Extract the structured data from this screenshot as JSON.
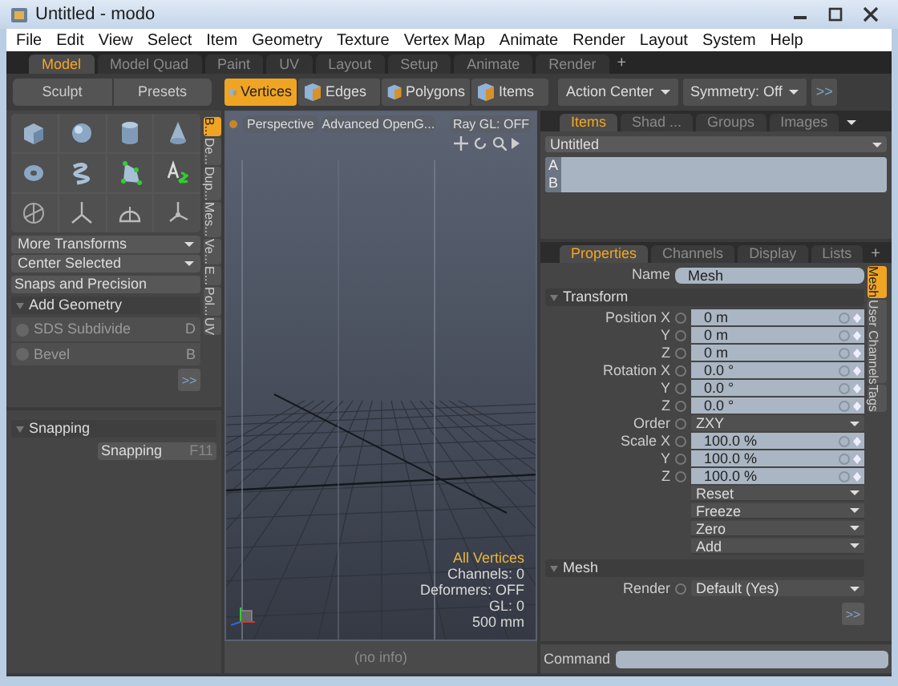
{
  "window": {
    "title": "Untitled - modo"
  },
  "menu": [
    "File",
    "Edit",
    "View",
    "Select",
    "Item",
    "Geometry",
    "Texture",
    "Vertex Map",
    "Animate",
    "Render",
    "Layout",
    "System",
    "Help"
  ],
  "layout_tabs": [
    {
      "label": "Model",
      "selected": true
    },
    {
      "label": "Model Quad",
      "selected": false
    },
    {
      "label": "Paint",
      "selected": false
    },
    {
      "label": "UV",
      "selected": false
    },
    {
      "label": "Layout",
      "selected": false
    },
    {
      "label": "Setup",
      "selected": false
    },
    {
      "label": "Animate",
      "selected": false
    },
    {
      "label": "Render",
      "selected": false
    }
  ],
  "add_tab": "+",
  "toolbar": {
    "left_buttons": [
      "Sculpt",
      "Presets"
    ],
    "modes": [
      {
        "label": "Vertices",
        "selected": true
      },
      {
        "label": "Edges",
        "selected": false
      },
      {
        "label": "Polygons",
        "selected": false
      },
      {
        "label": "Items",
        "selected": false
      }
    ],
    "action_center": "Action Center",
    "symmetry": "Symmetry: Off",
    "more": ">>"
  },
  "tool_panel": {
    "dropdowns": [
      "More Transforms",
      "Center Selected"
    ],
    "snaps": "Snaps and Precision",
    "add_geometry": {
      "title": "Add Geometry",
      "items": [
        {
          "label": "SDS Subdivide",
          "key": "D",
          "disabled": true
        },
        {
          "label": "Bevel",
          "key": "B",
          "disabled": true
        }
      ]
    },
    "more": ">>",
    "side_tabs": [
      {
        "label": "B...",
        "selected": true
      },
      {
        "label": "De...",
        "selected": false
      },
      {
        "label": "Dup...",
        "selected": false
      },
      {
        "label": "Mes...",
        "selected": false
      },
      {
        "label": "Ve...",
        "selected": false
      },
      {
        "label": "E...",
        "selected": false
      },
      {
        "label": "Pol...",
        "selected": false
      },
      {
        "label": "UV",
        "selected": false
      }
    ]
  },
  "snapping_panel": {
    "title": "Snapping",
    "button": {
      "label": "Snapping",
      "key": "F11"
    }
  },
  "viewport": {
    "view": "Perspective",
    "shading": "Advanced OpenG...",
    "ray_gl": "Ray GL: OFF",
    "info": [
      {
        "text": "All Vertices",
        "highlight": true
      },
      {
        "text": "Channels: 0",
        "highlight": false
      },
      {
        "text": "Deformers: OFF",
        "highlight": false
      },
      {
        "text": "GL: 0",
        "highlight": false
      },
      {
        "text": "500 mm",
        "highlight": false
      }
    ]
  },
  "status": "(no info)",
  "items_panel": {
    "tabs": [
      {
        "label": "Items",
        "selected": true
      },
      {
        "label": "Shad ...",
        "selected": false
      },
      {
        "label": "Groups",
        "selected": false
      },
      {
        "label": "Images",
        "selected": false
      }
    ],
    "scene": "Untitled",
    "rows": [
      "A",
      "B"
    ]
  },
  "properties": {
    "tabs": [
      {
        "label": "Properties",
        "selected": true
      },
      {
        "label": "Channels",
        "selected": false
      },
      {
        "label": "Display",
        "selected": false
      },
      {
        "label": "Lists",
        "selected": false
      }
    ],
    "add_tab": "+",
    "side_tabs": [
      {
        "label": "Mesh",
        "selected": true
      },
      {
        "label": "User Channels",
        "selected": false
      },
      {
        "label": "Tags",
        "selected": false
      }
    ],
    "name_label": "Name",
    "name": "Mesh",
    "sections": [
      {
        "title": "Transform",
        "rows": [
          {
            "kind": "field",
            "label": "Position X",
            "value": "0 m"
          },
          {
            "kind": "field",
            "label": "Y",
            "value": "0 m"
          },
          {
            "kind": "field",
            "label": "Z",
            "value": "0 m"
          },
          {
            "kind": "field",
            "label": "Rotation X",
            "value": "0.0 °"
          },
          {
            "kind": "field",
            "label": "Y",
            "value": "0.0 °"
          },
          {
            "kind": "field",
            "label": "Z",
            "value": "0.0 °"
          },
          {
            "kind": "dropdown",
            "label": "Order",
            "value": "ZXY"
          },
          {
            "kind": "field",
            "label": "Scale X",
            "value": "100.0 %"
          },
          {
            "kind": "field",
            "label": "Y",
            "value": "100.0 %"
          },
          {
            "kind": "field",
            "label": "Z",
            "value": "100.0 %"
          },
          {
            "kind": "menu",
            "value": "Reset"
          },
          {
            "kind": "menu",
            "value": "Freeze"
          },
          {
            "kind": "menu",
            "value": "Zero"
          },
          {
            "kind": "menu",
            "value": "Add"
          }
        ]
      },
      {
        "title": "Mesh",
        "rows": [
          {
            "kind": "dropdown",
            "label": "Render",
            "value": "Default (Yes)"
          }
        ]
      }
    ],
    "more": ">>"
  },
  "command": {
    "label": "Command"
  }
}
